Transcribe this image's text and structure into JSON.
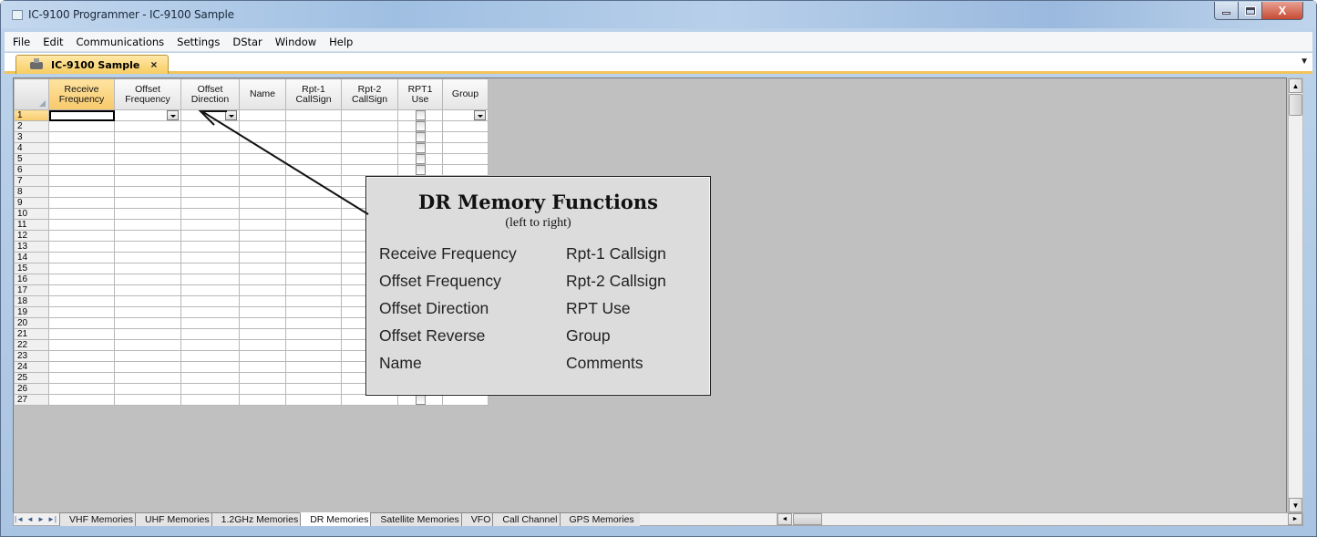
{
  "window": {
    "title": "IC-9100 Programmer - IC-9100 Sample",
    "close_glyph": "X"
  },
  "menu": [
    "File",
    "Edit",
    "Communications",
    "Settings",
    "DStar",
    "Window",
    "Help"
  ],
  "doc_tab": {
    "label": "IC-9100 Sample",
    "close": "×",
    "dropdown": "▼"
  },
  "grid": {
    "columns": [
      {
        "label": "Receive\nFrequency",
        "width": 72,
        "active": true,
        "type": "text"
      },
      {
        "label": "Offset\nFrequency",
        "width": 73,
        "type": "dropdown"
      },
      {
        "label": "Offset\nDirection",
        "width": 64,
        "type": "dropdown"
      },
      {
        "label": "Name",
        "width": 51,
        "type": "text"
      },
      {
        "label": "Rpt-1\nCallSign",
        "width": 61,
        "type": "text"
      },
      {
        "label": "Rpt-2\nCallSign",
        "width": 62,
        "type": "text"
      },
      {
        "label": "RPT1\nUse",
        "width": 49,
        "type": "checkbox"
      },
      {
        "label": "Group",
        "width": 50,
        "type": "dropdown"
      }
    ],
    "row_count": 27,
    "active_row": 1
  },
  "sheet_nav": [
    "|◄",
    "◄",
    "►",
    "►|"
  ],
  "sheet_tabs": [
    {
      "label": "VHF Memories"
    },
    {
      "label": "UHF Memories"
    },
    {
      "label": "1.2GHz Memories"
    },
    {
      "label": "DR Memories",
      "selected": true
    },
    {
      "label": "Satellite Memories"
    },
    {
      "label": "VFO"
    },
    {
      "label": "Call Channel"
    },
    {
      "label": "GPS Memories"
    }
  ],
  "callout": {
    "title": "DR Memory Functions",
    "subtitle": "(left to right)",
    "left_items": [
      "Receive Frequency",
      "Offset Frequency",
      "Offset Direction",
      "Offset Reverse",
      "Name"
    ],
    "right_items": [
      "Rpt-1 Callsign",
      "Rpt-2 Callsign",
      "RPT Use",
      "Group",
      "Comments"
    ]
  },
  "colors": {
    "active_header": "#f7c96a",
    "grid_background": "#c0c0c0",
    "callout_background": "#dcdcdc"
  }
}
